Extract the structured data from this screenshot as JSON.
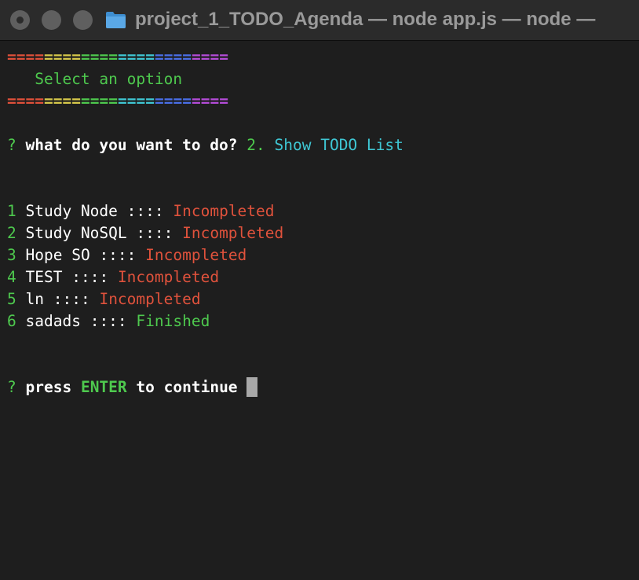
{
  "window": {
    "title": "project_1_TODO_Agenda — node app.js — node —"
  },
  "menu": {
    "separator_top": "========================",
    "title": "   Select an option",
    "separator_bottom": "========================",
    "rainbow_colors": [
      "#e0503a",
      "#d6c84a",
      "#4ec94e",
      "#3fc7d4",
      "#4a6fe8",
      "#b44cd8"
    ]
  },
  "prompt1": {
    "mark": "?",
    "question": "what do you want to do?",
    "answer_number": "2.",
    "answer_text": "Show TODO List"
  },
  "tasks": [
    {
      "index": "1",
      "name": "Study Node",
      "sep": "::::",
      "status": "Incompleted",
      "done": false
    },
    {
      "index": "2",
      "name": "Study NoSQL",
      "sep": "::::",
      "status": "Incompleted",
      "done": false
    },
    {
      "index": "3",
      "name": "Hope SO",
      "sep": "::::",
      "status": "Incompleted",
      "done": false
    },
    {
      "index": "4",
      "name": "TEST",
      "sep": "::::",
      "status": "Incompleted",
      "done": false
    },
    {
      "index": "5",
      "name": "ln",
      "sep": "::::",
      "status": "Incompleted",
      "done": false
    },
    {
      "index": "6",
      "name": "sadads",
      "sep": "::::",
      "status": "Finished",
      "done": true
    }
  ],
  "prompt2": {
    "mark": "?",
    "text_before": "press",
    "key": "ENTER",
    "text_after": "to continue"
  },
  "colors": {
    "background": "#1e1e1e",
    "titlebar": "#2b2b2b",
    "green": "#4ec94e",
    "cyan": "#3fc7d4",
    "red": "#e0523c",
    "cursor": "#a8a8a8"
  }
}
